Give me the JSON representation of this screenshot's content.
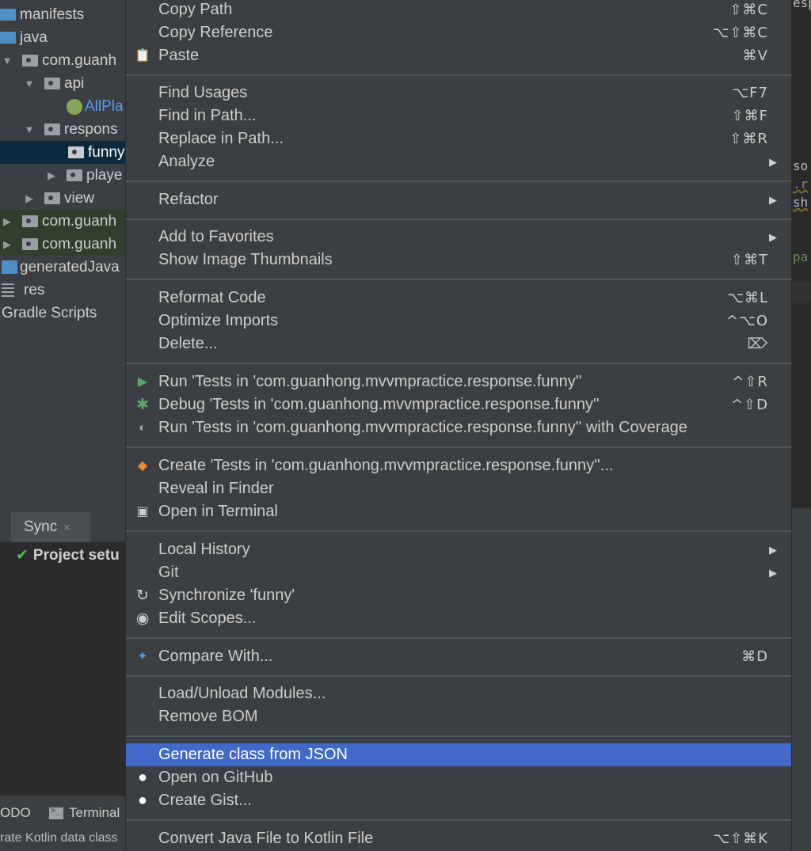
{
  "colors": {
    "menu_bg": "#3c3f41",
    "menu_highlight": "#4169c7",
    "tree_selection": "#0d293e",
    "editor_bg": "#2b2b2b",
    "check_green": "#5fb25a",
    "run_green": "#59a869",
    "link_blue": "#589df6"
  },
  "tree": {
    "items": [
      {
        "label": "manifests",
        "icon": "folder-icon"
      },
      {
        "label": "java",
        "icon": "folder-icon"
      },
      {
        "label": "com.guanh",
        "icon": "package-icon",
        "arrow": "▼"
      },
      {
        "label": "api",
        "icon": "package-icon",
        "arrow": "▼"
      },
      {
        "label": "AllPla",
        "icon": "kotlin-file-icon"
      },
      {
        "label": "respons",
        "icon": "package-icon",
        "arrow": "▼"
      },
      {
        "label": "funny",
        "icon": "package-icon"
      },
      {
        "label": "playe",
        "icon": "package-icon",
        "arrow": "▶"
      },
      {
        "label": "view",
        "icon": "package-icon",
        "arrow": "▶"
      },
      {
        "label": "com.guanh",
        "icon": "package-icon",
        "arrow": "▶"
      },
      {
        "label": "com.guanh",
        "icon": "package-icon",
        "arrow": "▶"
      },
      {
        "label": "generatedJava",
        "icon": "generated-folder-icon"
      },
      {
        "label": "res",
        "icon": "resources-folder-icon"
      },
      {
        "label": "Gradle Scripts",
        "icon": ""
      }
    ]
  },
  "editor": {
    "snippets": [
      "esp",
      "so",
      ".r",
      "sh",
      "pa"
    ]
  },
  "sync": {
    "tab_label": "Sync",
    "close_glyph": "×",
    "check_glyph": "✔",
    "project_setup": "Project setu"
  },
  "bottom": {
    "todo_label": "ODO",
    "terminal_label": "Terminal",
    "status_text": "rate Kotlin data class"
  },
  "menu": {
    "copy_path": {
      "label": "Copy Path",
      "shortcut": "⇧⌘C"
    },
    "copy_reference": {
      "label": "Copy Reference",
      "shortcut": "⌥⇧⌘C"
    },
    "paste": {
      "label": "Paste",
      "shortcut": "⌘V",
      "icon": "📋"
    },
    "find_usages": {
      "label": "Find Usages",
      "shortcut": "⌥F7"
    },
    "find_in_path": {
      "label": "Find in Path...",
      "shortcut": "⇧⌘F"
    },
    "replace_in_path": {
      "label": "Replace in Path...",
      "shortcut": "⇧⌘R"
    },
    "analyze": {
      "label": "Analyze"
    },
    "refactor": {
      "label": "Refactor"
    },
    "add_to_favorites": {
      "label": "Add to Favorites"
    },
    "show_image_thumbnails": {
      "label": "Show Image Thumbnails",
      "shortcut": "⇧⌘T"
    },
    "reformat_code": {
      "label": "Reformat Code",
      "shortcut": "⌥⌘L"
    },
    "optimize_imports": {
      "label": "Optimize Imports",
      "shortcut": "^⌥O"
    },
    "delete": {
      "label": "Delete...",
      "shortcut": "⌦"
    },
    "run_tests": {
      "label": "Run 'Tests in 'com.guanhong.mvvmpractice.response.funny''",
      "shortcut": "^⇧R",
      "icon": "▶"
    },
    "debug_tests": {
      "label": "Debug 'Tests in 'com.guanhong.mvvmpractice.response.funny''",
      "shortcut": "^⇧D",
      "icon": "✱"
    },
    "run_coverage": {
      "label": "Run 'Tests in 'com.guanhong.mvvmpractice.response.funny'' with Coverage",
      "icon": "◐"
    },
    "create_tests": {
      "label": "Create 'Tests in 'com.guanhong.mvvmpractice.response.funny''...",
      "icon": "◆"
    },
    "reveal_in_finder": {
      "label": "Reveal in Finder"
    },
    "open_in_terminal": {
      "label": "Open in Terminal",
      "icon": "▣"
    },
    "local_history": {
      "label": "Local History"
    },
    "git": {
      "label": "Git"
    },
    "synchronize": {
      "label": "Synchronize 'funny'",
      "icon": "↻"
    },
    "edit_scopes": {
      "label": "Edit Scopes...",
      "icon": "◉"
    },
    "compare_with": {
      "label": "Compare With...",
      "shortcut": "⌘D",
      "icon": "✦"
    },
    "load_unload_modules": {
      "label": "Load/Unload Modules..."
    },
    "remove_bom": {
      "label": "Remove BOM"
    },
    "generate_class_from_json": {
      "label": "Generate class from JSON"
    },
    "open_on_github": {
      "label": "Open on GitHub",
      "icon": "●"
    },
    "create_gist": {
      "label": "Create Gist...",
      "icon": "●"
    },
    "convert_java_to_kotlin": {
      "label": "Convert Java File to Kotlin File",
      "shortcut": "⌥⇧⌘K"
    },
    "submenu_arrow": "▶"
  }
}
